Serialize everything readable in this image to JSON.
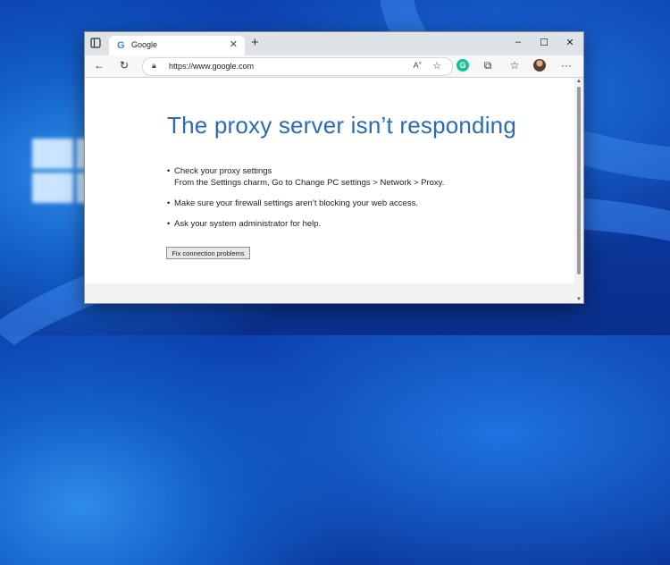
{
  "tab": {
    "favicon": "G",
    "title": "Google"
  },
  "address": {
    "url": "https://www.google.com"
  },
  "window_controls": {
    "minimize": "–",
    "maximize": "☐",
    "close": "✕"
  },
  "page": {
    "headline": "The proxy server isn’t responding",
    "tips": [
      {
        "main": "Check your proxy settings",
        "sub": "From the Settings charm, Go to Change PC settings > Network > Proxy."
      },
      {
        "main": "Make sure your firewall settings aren’t blocking your web access."
      },
      {
        "main": "Ask your system administrator for help."
      }
    ],
    "fix_button": "Fix connection problems"
  },
  "icons": [
    "tab-actions-icon",
    "google-favicon-icon",
    "close-icon",
    "plus-icon",
    "back-icon",
    "refresh-icon",
    "lock-icon",
    "read-aloud-icon",
    "favorite-icon",
    "grammarly-icon",
    "extensions-icon",
    "favorites-icon",
    "profile-avatar",
    "more-icon"
  ],
  "colors": {
    "headline": "#2a6bb8",
    "titlebar": "#dfe3e8",
    "grammarly": "#15c39a"
  }
}
